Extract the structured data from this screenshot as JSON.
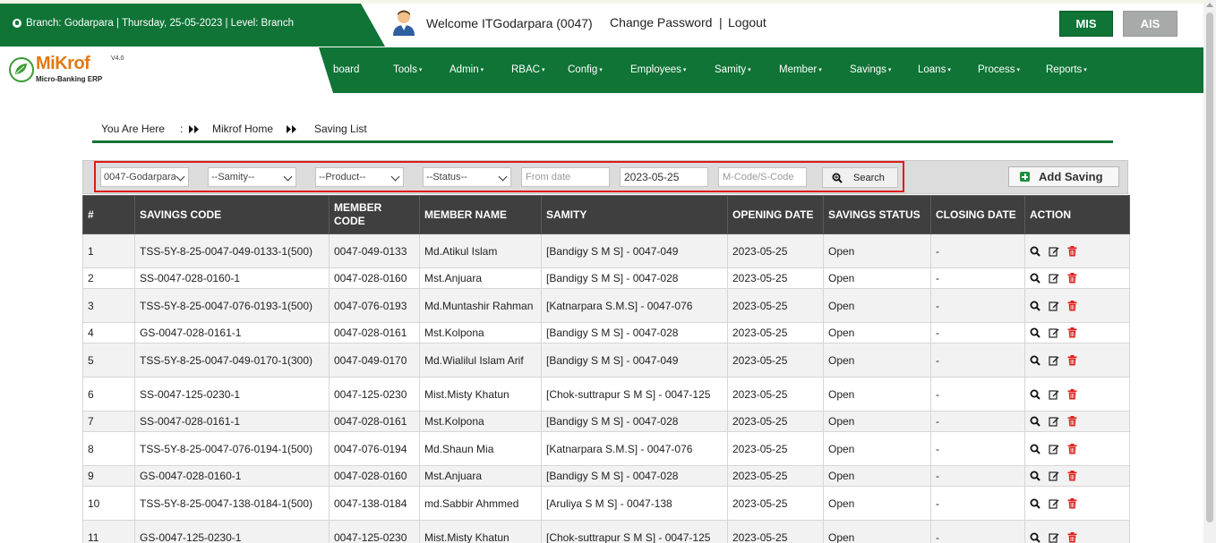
{
  "header": {
    "branch_info": "Branch: Godarpara | Thursday, 25-05-2023 | Level: Branch",
    "welcome": "Welcome ITGodarpara (0047)",
    "change_password": "Change Password",
    "separator": "|",
    "logout": "Logout",
    "mis_label": "MIS",
    "ais_label": "AIS"
  },
  "logo": {
    "name": "MiKrof",
    "version": "V4.0",
    "tagline": "Micro-Banking ERP"
  },
  "nav": {
    "items": [
      "board",
      "Tools",
      "Admin",
      "RBAC",
      "Config",
      "Employees",
      "Samity",
      "Member",
      "Savings",
      "Loans",
      "Process",
      "Reports"
    ]
  },
  "breadcrumb": {
    "prefix": "You Are Here",
    "colon": ":",
    "home": "Mikrof Home",
    "current": "Saving List"
  },
  "filters": {
    "branch": "0047-Godarpara",
    "samity": "--Samity--",
    "product": "--Product--",
    "status": "--Status--",
    "from_date_placeholder": "From date",
    "to_date": "2023-05-25",
    "code_placeholder": "M-Code/S-Code",
    "search_label": "Search",
    "add_label": "Add Saving"
  },
  "table": {
    "headers": {
      "idx": "#",
      "code": "SAVINGS CODE",
      "member_code": "MEMBER CODE",
      "member_name": "MEMBER NAME",
      "samity": "SAMITY",
      "opening": "OPENING DATE",
      "status": "SAVINGS STATUS",
      "closing": "CLOSING DATE",
      "action": "ACTION"
    },
    "rows": [
      {
        "idx": "1",
        "code": "TSS-5Y-8-25-0047-049-0133-1(500)",
        "member_code": "0047-049-0133",
        "member_name": "Md.Atikul Islam",
        "samity": "[Bandigy S M S] - 0047-049",
        "opening": "2023-05-25",
        "status": "Open",
        "closing": "-"
      },
      {
        "idx": "2",
        "code": "SS-0047-028-0160-1",
        "member_code": "0047-028-0160",
        "member_name": "Mst.Anjuara",
        "samity": "[Bandigy S M S] - 0047-028",
        "opening": "2023-05-25",
        "status": "Open",
        "closing": "-"
      },
      {
        "idx": "3",
        "code": "TSS-5Y-8-25-0047-076-0193-1(500)",
        "member_code": "0047-076-0193",
        "member_name": "Md.Muntashir Rahman",
        "samity": "[Katnarpara S.M.S] - 0047-076",
        "opening": "2023-05-25",
        "status": "Open",
        "closing": "-"
      },
      {
        "idx": "4",
        "code": "GS-0047-028-0161-1",
        "member_code": "0047-028-0161",
        "member_name": "Mst.Kolpona",
        "samity": "[Bandigy S M S] - 0047-028",
        "opening": "2023-05-25",
        "status": "Open",
        "closing": "-"
      },
      {
        "idx": "5",
        "code": "TSS-5Y-8-25-0047-049-0170-1(300)",
        "member_code": "0047-049-0170",
        "member_name": "Md.Wialilul Islam Arif",
        "samity": "[Bandigy S M S] - 0047-049",
        "opening": "2023-05-25",
        "status": "Open",
        "closing": "-"
      },
      {
        "idx": "6",
        "code": "SS-0047-125-0230-1",
        "member_code": "0047-125-0230",
        "member_name": "Mist.Misty Khatun",
        "samity": "[Chok-suttrapur S M S] - 0047-125",
        "opening": "2023-05-25",
        "status": "Open",
        "closing": "-"
      },
      {
        "idx": "7",
        "code": "SS-0047-028-0161-1",
        "member_code": "0047-028-0161",
        "member_name": "Mst.Kolpona",
        "samity": "[Bandigy S M S] - 0047-028",
        "opening": "2023-05-25",
        "status": "Open",
        "closing": "-"
      },
      {
        "idx": "8",
        "code": "TSS-5Y-8-25-0047-076-0194-1(500)",
        "member_code": "0047-076-0194",
        "member_name": "Md.Shaun Mia",
        "samity": "[Katnarpara S.M.S] - 0047-076",
        "opening": "2023-05-25",
        "status": "Open",
        "closing": "-"
      },
      {
        "idx": "9",
        "code": "GS-0047-028-0160-1",
        "member_code": "0047-028-0160",
        "member_name": "Mst.Anjuara",
        "samity": "[Bandigy S M S] - 0047-028",
        "opening": "2023-05-25",
        "status": "Open",
        "closing": "-"
      },
      {
        "idx": "10",
        "code": "TSS-5Y-8-25-0047-138-0184-1(500)",
        "member_code": "0047-138-0184",
        "member_name": "md.Sabbir Ahmmed",
        "samity": "[Aruliya S M S] - 0047-138",
        "opening": "2023-05-25",
        "status": "Open",
        "closing": "-"
      },
      {
        "idx": "11",
        "code": "GS-0047-125-0230-1",
        "member_code": "0047-125-0230",
        "member_name": "Mist.Misty Khatun",
        "samity": "[Chok-suttrapur S M S] - 0047-125",
        "opening": "2023-05-25",
        "status": "Open",
        "closing": "-"
      }
    ]
  },
  "icons": {
    "view": "search-icon",
    "edit": "edit-icon",
    "delete": "trash-icon"
  },
  "colors": {
    "brand_green": "#0f7436",
    "header_dark": "#3f3f3f",
    "highlight_red": "#e01a1a",
    "delete_red": "#e02020"
  }
}
